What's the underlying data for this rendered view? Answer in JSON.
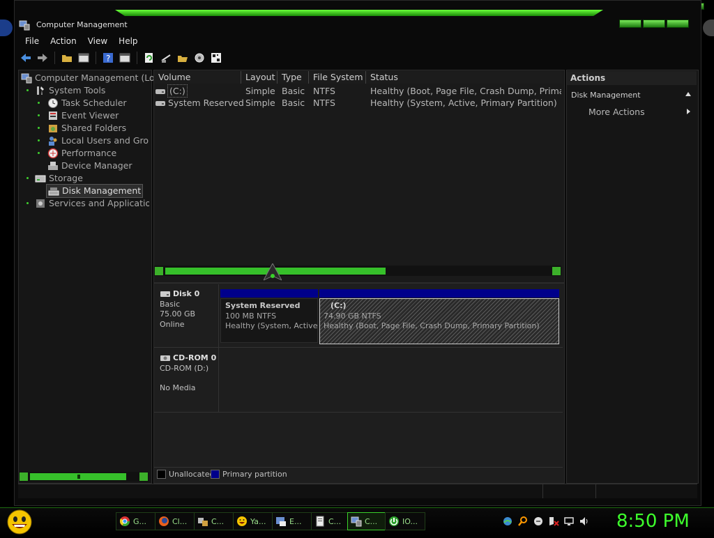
{
  "window": {
    "title": "Computer Management"
  },
  "menu": [
    "File",
    "Action",
    "View",
    "Help"
  ],
  "tree": {
    "root": "Computer Management (Loc",
    "items": [
      {
        "label": "System Tools",
        "icon": "tools-icon"
      },
      {
        "label": "Task Scheduler",
        "icon": "clock-icon"
      },
      {
        "label": "Event Viewer",
        "icon": "event-viewer-icon"
      },
      {
        "label": "Shared Folders",
        "icon": "shared-folders-icon"
      },
      {
        "label": "Local Users and Grou",
        "icon": "users-icon"
      },
      {
        "label": "Performance",
        "icon": "performance-icon"
      },
      {
        "label": "Device Manager",
        "icon": "device-manager-icon"
      },
      {
        "label": "Storage",
        "icon": "storage-icon"
      },
      {
        "label": "Disk Management",
        "icon": "disk-management-icon"
      },
      {
        "label": "Services and Application",
        "icon": "services-icon"
      }
    ]
  },
  "volumes": {
    "columns": [
      "Volume",
      "Layout",
      "Type",
      "File System",
      "Status"
    ],
    "rows": [
      [
        "(C:)",
        "Simple",
        "Basic",
        "NTFS",
        "Healthy (Boot, Page File, Crash Dump, Primary"
      ],
      [
        "System Reserved",
        "Simple",
        "Basic",
        "NTFS",
        "Healthy (System, Active, Primary Partition)"
      ]
    ]
  },
  "disks": {
    "disk0": {
      "name": "Disk 0",
      "type": "Basic",
      "size": "75.00 GB",
      "state": "Online"
    },
    "partitions": [
      {
        "name": "System Reserved",
        "size": "100 MB NTFS",
        "status": "Healthy (System, Active, P"
      },
      {
        "name": "(C:)",
        "size": "74.90 GB NTFS",
        "status": "Healthy (Boot, Page File, Crash Dump, Primary Partition)"
      }
    ],
    "cdrom": {
      "name": "CD-ROM 0",
      "type": "CD-ROM (D:)",
      "state": "No Media"
    }
  },
  "legend": [
    "Unallocated",
    "Primary partition"
  ],
  "actions": {
    "header": "Actions",
    "section": "Disk Management",
    "more": "More Actions"
  },
  "taskbar": {
    "tasks": [
      {
        "label": "G...",
        "icon": "chrome-icon"
      },
      {
        "label": "Cl...",
        "icon": "firefox-icon"
      },
      {
        "label": "C...",
        "icon": "control-icon"
      },
      {
        "label": "Ya...",
        "icon": "yahoo-icon"
      },
      {
        "label": "E...",
        "icon": "explorer-icon"
      },
      {
        "label": "C...",
        "icon": "document-icon"
      },
      {
        "label": "C...",
        "icon": "computer-management-icon"
      },
      {
        "label": "IO...",
        "icon": "iobit-icon"
      }
    ],
    "clock": "8:50 PM"
  },
  "colors": {
    "accent": "#3dff2c",
    "primary_partition": "#00008b"
  }
}
